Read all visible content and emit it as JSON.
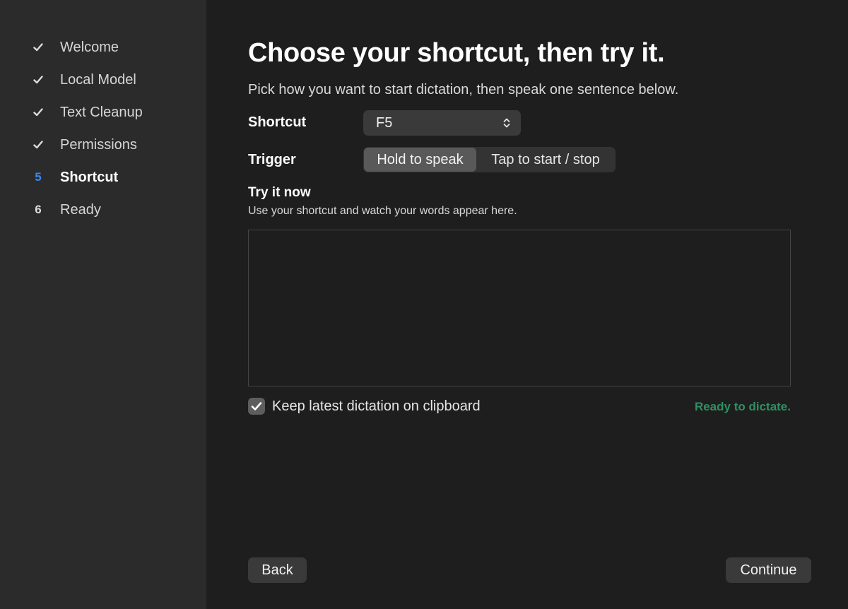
{
  "sidebar": {
    "steps": [
      {
        "marker": "check",
        "label": "Welcome",
        "state": "done"
      },
      {
        "marker": "check",
        "label": "Local Model",
        "state": "done"
      },
      {
        "marker": "check",
        "label": "Text Cleanup",
        "state": "done"
      },
      {
        "marker": "check",
        "label": "Permissions",
        "state": "done"
      },
      {
        "marker": "5",
        "label": "Shortcut",
        "state": "current"
      },
      {
        "marker": "6",
        "label": "Ready",
        "state": "upcoming"
      }
    ]
  },
  "main": {
    "title": "Choose your shortcut, then try it.",
    "subtitle": "Pick how you want to start dictation, then speak one sentence below.",
    "shortcut": {
      "label": "Shortcut",
      "value": "F5",
      "icon": "chevron-up-down-icon"
    },
    "trigger": {
      "label": "Trigger",
      "options": [
        "Hold to speak",
        "Tap to start / stop"
      ],
      "selected": "Hold to speak"
    },
    "try_it": {
      "title": "Try it now",
      "hint": "Use your shortcut and watch your words appear here.",
      "value": ""
    },
    "clipboard": {
      "label": "Keep latest dictation on clipboard",
      "checked": true
    },
    "status": "Ready to dictate.",
    "buttons": {
      "back": "Back",
      "continue": "Continue"
    }
  },
  "colors": {
    "sidebar_bg": "#2b2b2b",
    "main_bg": "#1e1e1e",
    "accent_step": "#3d86f0",
    "status_green": "#2f8f63"
  }
}
